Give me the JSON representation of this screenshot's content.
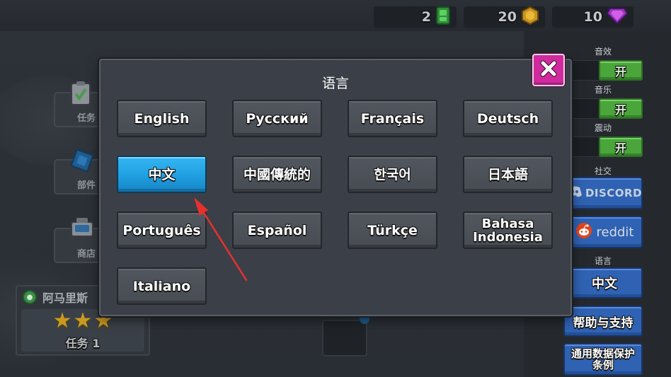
{
  "top_bar": {
    "currencies": [
      {
        "value": "2",
        "icon": "green-ticket-icon"
      },
      {
        "value": "20",
        "icon": "gold-coin-icon"
      },
      {
        "value": "10",
        "icon": "purple-gem-icon"
      }
    ]
  },
  "left_menu": {
    "items": [
      {
        "label": "任务",
        "icon": "clipboard-icon"
      },
      {
        "label": "部件",
        "icon": "part-icon"
      },
      {
        "label": "商店",
        "icon": "shop-icon"
      }
    ]
  },
  "mission_panel": {
    "name": "阿马里斯",
    "stars": 3,
    "mission": "任务 1"
  },
  "settings": {
    "sound": {
      "label": "音效",
      "toggle": "开"
    },
    "music": {
      "label": "音乐",
      "toggle": "开"
    },
    "vibration": {
      "label": "震动",
      "toggle": "开"
    },
    "social_label": "社交",
    "discord_label": "DISCORD",
    "reddit_label": "reddit",
    "language_label": "语言",
    "language_value": "中文",
    "help_label": "帮助与支持",
    "gdpr_label": "通用数据保护条例"
  },
  "dialog": {
    "title": "语言",
    "languages": [
      "English",
      "Русский",
      "Français",
      "Deutsch",
      "中文",
      "中國傳統的",
      "한국어",
      "日本語",
      "Português",
      "Español",
      "Türkçe",
      "Bahasa Indonesia",
      "Italiano"
    ],
    "close_icon": "close-icon"
  },
  "colors": {
    "selected_button": "#1f9fe0",
    "close_button": "#d02a9e",
    "toggle_on": "#4aa53b",
    "settings_button": "#2f62b2",
    "annotation_arrow": "#e8302f"
  }
}
